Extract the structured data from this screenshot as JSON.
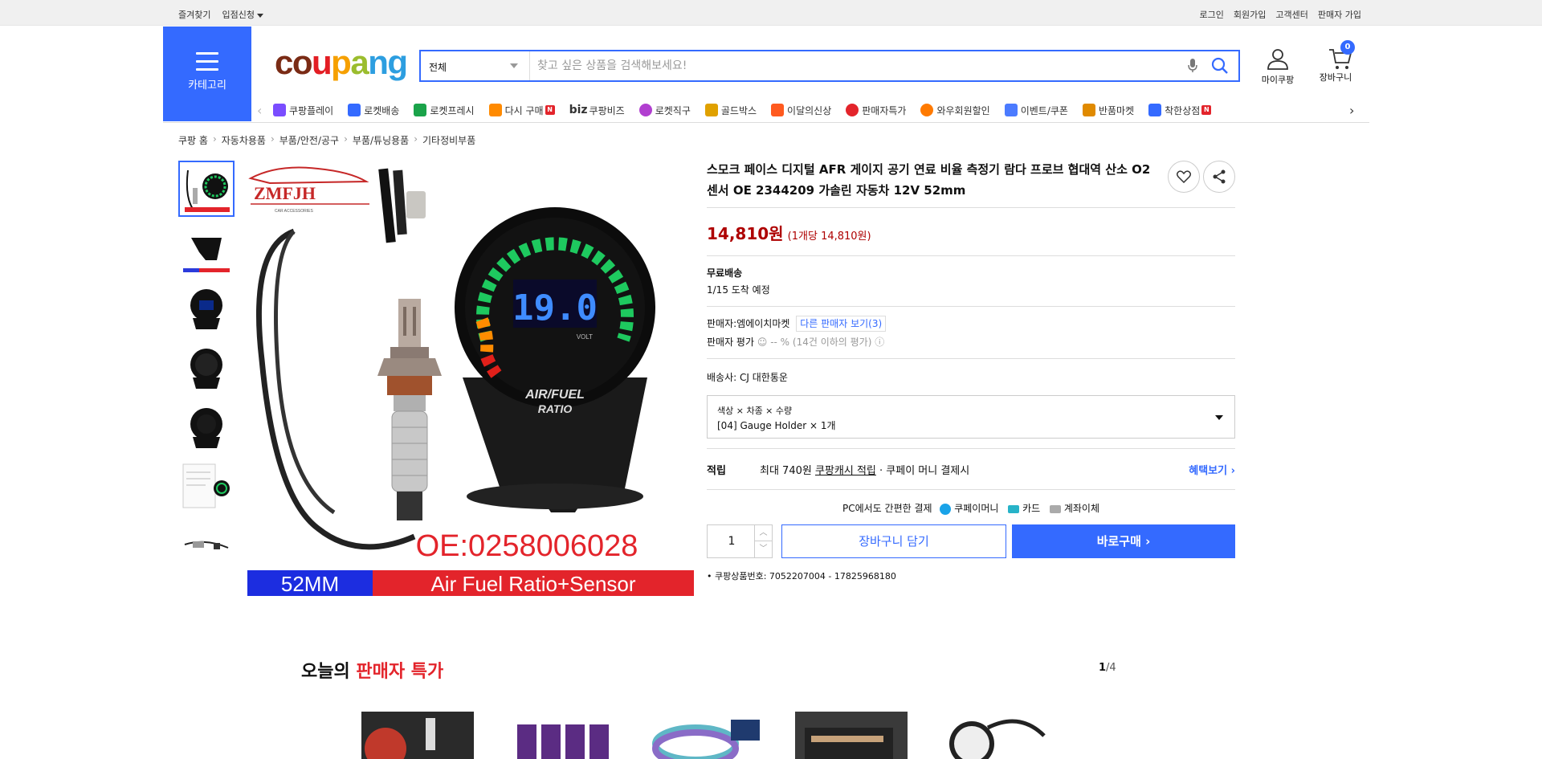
{
  "topbar": {
    "left": [
      "즐겨찾기",
      "입점신청"
    ],
    "right": [
      "로그인",
      "회원가입",
      "고객센터",
      "판매자 가입"
    ]
  },
  "header": {
    "category_label": "카테고리",
    "logo": "coupang",
    "search_category": "전체",
    "search_placeholder": "찾고 싶은 상품을 검색해보세요!",
    "my_label": "마이쿠팡",
    "cart_label": "장바구니",
    "cart_count": "0"
  },
  "nav": {
    "items": [
      {
        "label": "쿠팡플레이",
        "icon": "play-icon",
        "color": "#7a4dff"
      },
      {
        "label": "로켓배송",
        "icon": "rocket-icon",
        "color": "#346aff"
      },
      {
        "label": "로켓프레시",
        "icon": "rocket-fresh-icon",
        "color": "#1aa34a"
      },
      {
        "label": "다시 구매",
        "icon": "rebuy-icon",
        "color": "#ff8a00"
      },
      {
        "label": "쿠팡비즈",
        "prefix": "biz",
        "icon": "biz-icon",
        "color": "#333"
      },
      {
        "label": "로켓직구",
        "icon": "global-icon",
        "color": "#b13fd0"
      },
      {
        "label": "골드박스",
        "icon": "goldbox-icon",
        "color": "#e0a100"
      },
      {
        "label": "이달의신상",
        "icon": "new-icon",
        "color": "#ff5a1f"
      },
      {
        "label": "판매자특가",
        "icon": "seller-deal-icon",
        "color": "#e3242b"
      },
      {
        "label": "와우회원할인",
        "icon": "wow-icon",
        "color": "#ff7a00"
      },
      {
        "label": "이벤트/쿠폰",
        "icon": "coupon-icon",
        "color": "#4b7bff"
      },
      {
        "label": "반품마켓",
        "icon": "return-market-icon",
        "color": "#e08a00"
      },
      {
        "label": "착한상점",
        "icon": "good-shop-icon",
        "color": "#346aff"
      }
    ]
  },
  "breadcrumb": [
    "쿠팡 홈",
    "자동차용품",
    "부품/안전/공구",
    "부품/튜닝용품",
    "기타정비부품"
  ],
  "product": {
    "title": "스모크 페이스 디지털 AFR 게이지 공기 연료 비율 측정기 람다 프로브 협대역 산소 O2 센서 OE 2344209 가솔린 자동차 12V 52mm",
    "price": "14,810원",
    "unit_price": "(1개당 14,810원)",
    "shipping": "무료배송",
    "arrival": "1/15 도착 예정",
    "seller_label": "판매자:",
    "seller_name": "엠에이치마켓",
    "other_sellers": "다른 판매자 보기(3)",
    "seller_rating_label": "판매자 평가",
    "seller_rating_value": "-- %",
    "seller_rating_note": "(14건 이하의 평가)",
    "carrier_label": "배송사:",
    "carrier": "CJ 대한통운",
    "option_header": "색상 × 차종 × 수량",
    "option_value": "[04] Gauge Holder × 1개",
    "reward_label": "적립",
    "reward_prefix": "최대 740원",
    "reward_link": "쿠팡캐시 적립",
    "reward_suffix": "· 쿠페이 머니 결제시",
    "benefit_link": "혜택보기",
    "pay_prefix": "PC에서도 간편한 결제",
    "pay_options": [
      "쿠페이머니",
      "카드",
      "계좌이체"
    ],
    "quantity": "1",
    "cart_button": "장바구니 담기",
    "buy_button": "바로구매",
    "product_number": "쿠팡상품번호: 7052207004 - 17825968180",
    "image_texts": {
      "brand": "ZMFJH",
      "brand_sub": "CAR ACCESSORIES",
      "gauge_value": "19.0",
      "gauge_unit": "VOLT",
      "gauge_label1": "AIR/FUEL",
      "gauge_label2": "RATIO",
      "oe_code": "OE:0258006028",
      "size": "52MM",
      "banner": "Air Fuel Ratio+Sensor"
    }
  },
  "deals": {
    "title_prefix": "오늘의",
    "title_highlight": "판매자 특가",
    "page_current": "1",
    "page_total": "/4"
  }
}
